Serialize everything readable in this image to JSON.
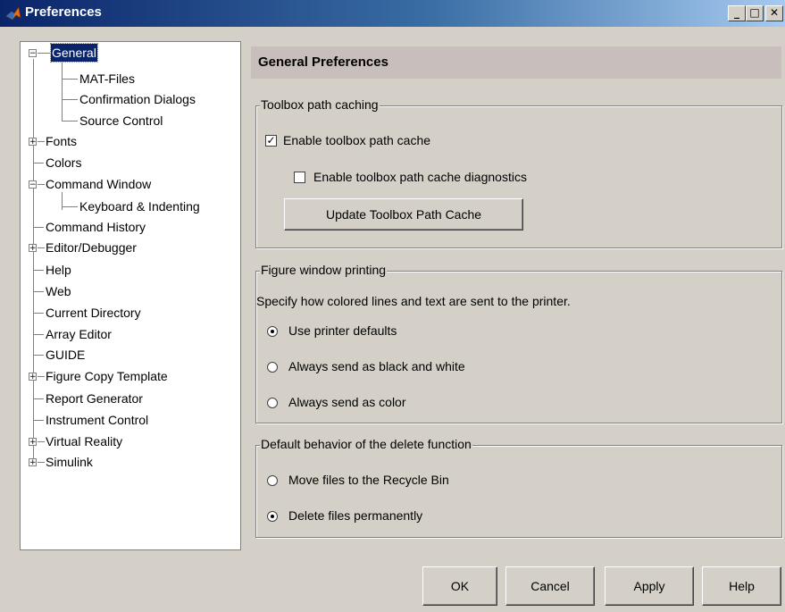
{
  "window": {
    "title": "Preferences",
    "minimize_label": "_",
    "maximize_label": "□",
    "close_label": "✕"
  },
  "tree": {
    "items": [
      {
        "label": "General",
        "level": 0,
        "expander": "−",
        "selected": true
      },
      {
        "label": "MAT-Files",
        "level": 1
      },
      {
        "label": "Confirmation Dialogs",
        "level": 1
      },
      {
        "label": "Source Control",
        "level": 1
      },
      {
        "label": "Fonts",
        "level": 0,
        "expander": "+"
      },
      {
        "label": "Colors",
        "level": 0
      },
      {
        "label": "Command Window",
        "level": 0,
        "expander": "−"
      },
      {
        "label": "Keyboard & Indenting",
        "level": 1
      },
      {
        "label": "Command History",
        "level": 0
      },
      {
        "label": "Editor/Debugger",
        "level": 0,
        "expander": "+"
      },
      {
        "label": "Help",
        "level": 0
      },
      {
        "label": "Web",
        "level": 0
      },
      {
        "label": "Current Directory",
        "level": 0
      },
      {
        "label": "Array Editor",
        "level": 0
      },
      {
        "label": "GUIDE",
        "level": 0
      },
      {
        "label": "Figure Copy Template",
        "level": 0,
        "expander": "+"
      },
      {
        "label": "Report Generator",
        "level": 0
      },
      {
        "label": "Instrument Control",
        "level": 0
      },
      {
        "label": "Virtual Reality",
        "level": 0,
        "expander": "+"
      },
      {
        "label": "Simulink",
        "level": 0,
        "expander": "+"
      }
    ]
  },
  "panel": {
    "header": "General Preferences",
    "toolbox": {
      "legend": "Toolbox path caching",
      "enable_cache": {
        "label": "Enable toolbox path cache",
        "checked": true
      },
      "enable_diag": {
        "label": "Enable toolbox path cache diagnostics",
        "checked": false
      },
      "update_button": "Update Toolbox Path Cache"
    },
    "printing": {
      "legend": "Figure window printing",
      "description": "Specify how colored lines and text are sent to the printer.",
      "options": [
        {
          "label": "Use printer defaults",
          "selected": true
        },
        {
          "label": "Always send as black and white",
          "selected": false
        },
        {
          "label": "Always send as color",
          "selected": false
        }
      ]
    },
    "delete": {
      "legend": "Default behavior of the delete function",
      "options": [
        {
          "label": "Move files to the Recycle Bin",
          "selected": false
        },
        {
          "label": "Delete files permanently",
          "selected": true
        }
      ]
    }
  },
  "buttons": {
    "ok": "OK",
    "cancel": "Cancel",
    "apply": "Apply",
    "help": "Help"
  },
  "colors": {
    "titlebar_start": "#0a246a",
    "header_bg": "#c8bebb",
    "window_bg": "#d4d0c8",
    "selection": "#0a246a"
  }
}
